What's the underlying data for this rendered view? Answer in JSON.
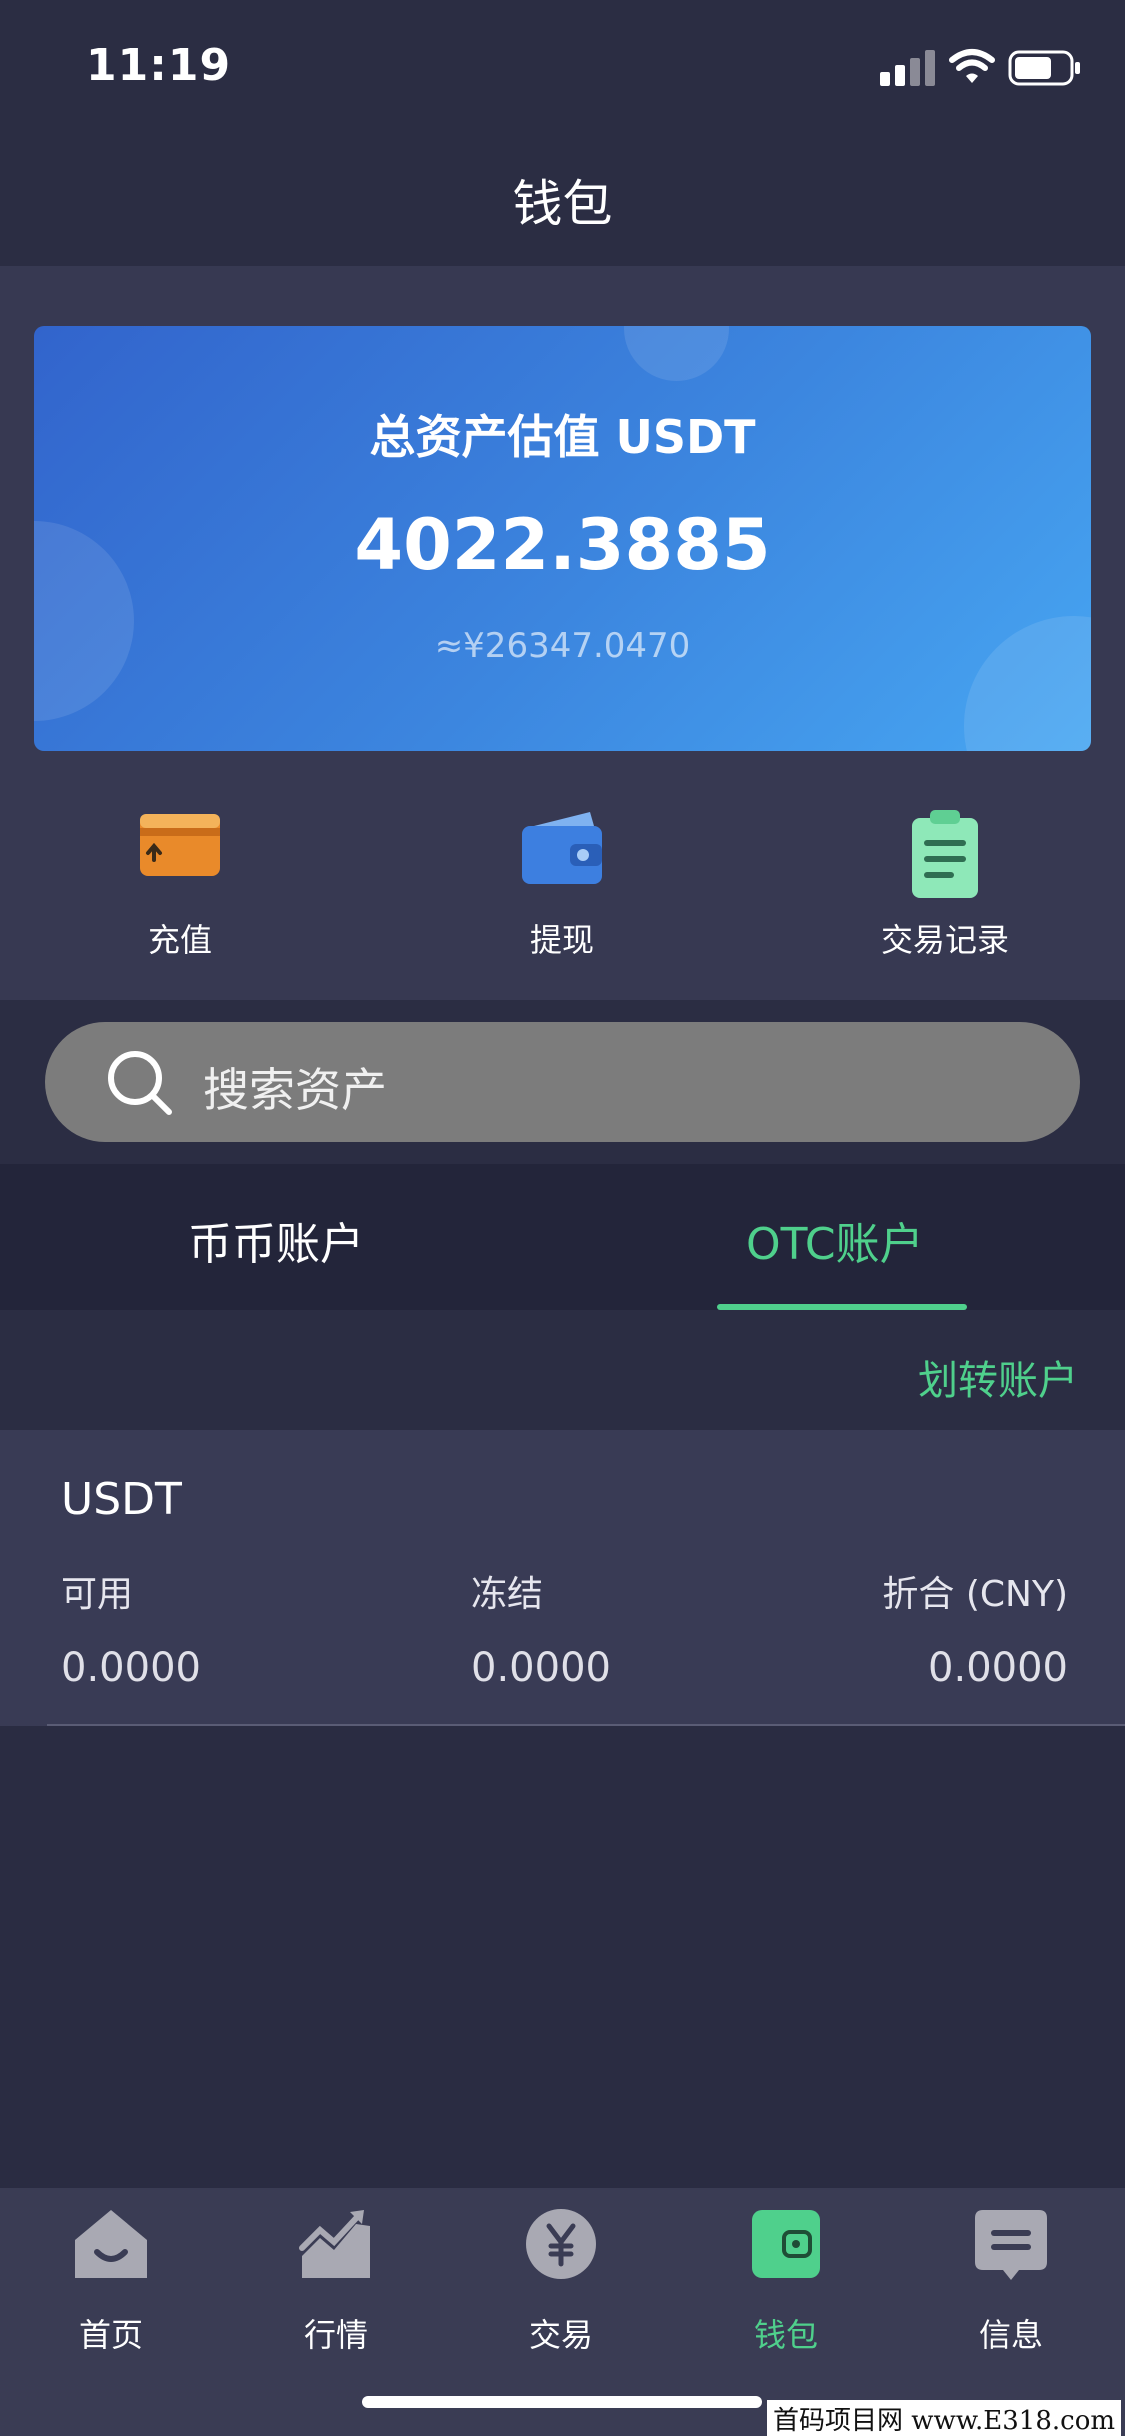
{
  "status_bar": {
    "time": "11:19"
  },
  "header": {
    "title": "钱包"
  },
  "asset_card": {
    "label": "总资产估值 USDT",
    "amount": "4022.3885",
    "cny_estimate": "≈¥26347.0470"
  },
  "actions": [
    {
      "label": "充值",
      "icon": "deposit-card-icon"
    },
    {
      "label": "提现",
      "icon": "wallet-icon"
    },
    {
      "label": "交易记录",
      "icon": "clipboard-icon"
    }
  ],
  "search": {
    "placeholder": "搜索资产"
  },
  "account_tabs": [
    {
      "label": "币币账户",
      "active": false
    },
    {
      "label": "OTC账户",
      "active": true
    }
  ],
  "transfer": {
    "label": "划转账户"
  },
  "assets": [
    {
      "coin": "USDT",
      "available_label": "可用",
      "available": "0.0000",
      "frozen_label": "冻结",
      "frozen": "0.0000",
      "value_label": "折合 (CNY)",
      "value": "0.0000"
    }
  ],
  "tab_bar": [
    {
      "label": "首页",
      "icon": "home-icon",
      "active": false
    },
    {
      "label": "行情",
      "icon": "market-chart-icon",
      "active": false
    },
    {
      "label": "交易",
      "icon": "yuan-coin-icon",
      "active": false
    },
    {
      "label": "钱包",
      "icon": "wallet-icon",
      "active": true
    },
    {
      "label": "信息",
      "icon": "message-icon",
      "active": false
    }
  ],
  "watermark": "首码项目网 www.E318.com",
  "colors": {
    "accent": "#4fd08c",
    "background": "#2a2c42",
    "card_start": "#3264cc",
    "card_end": "#47a6f2"
  }
}
